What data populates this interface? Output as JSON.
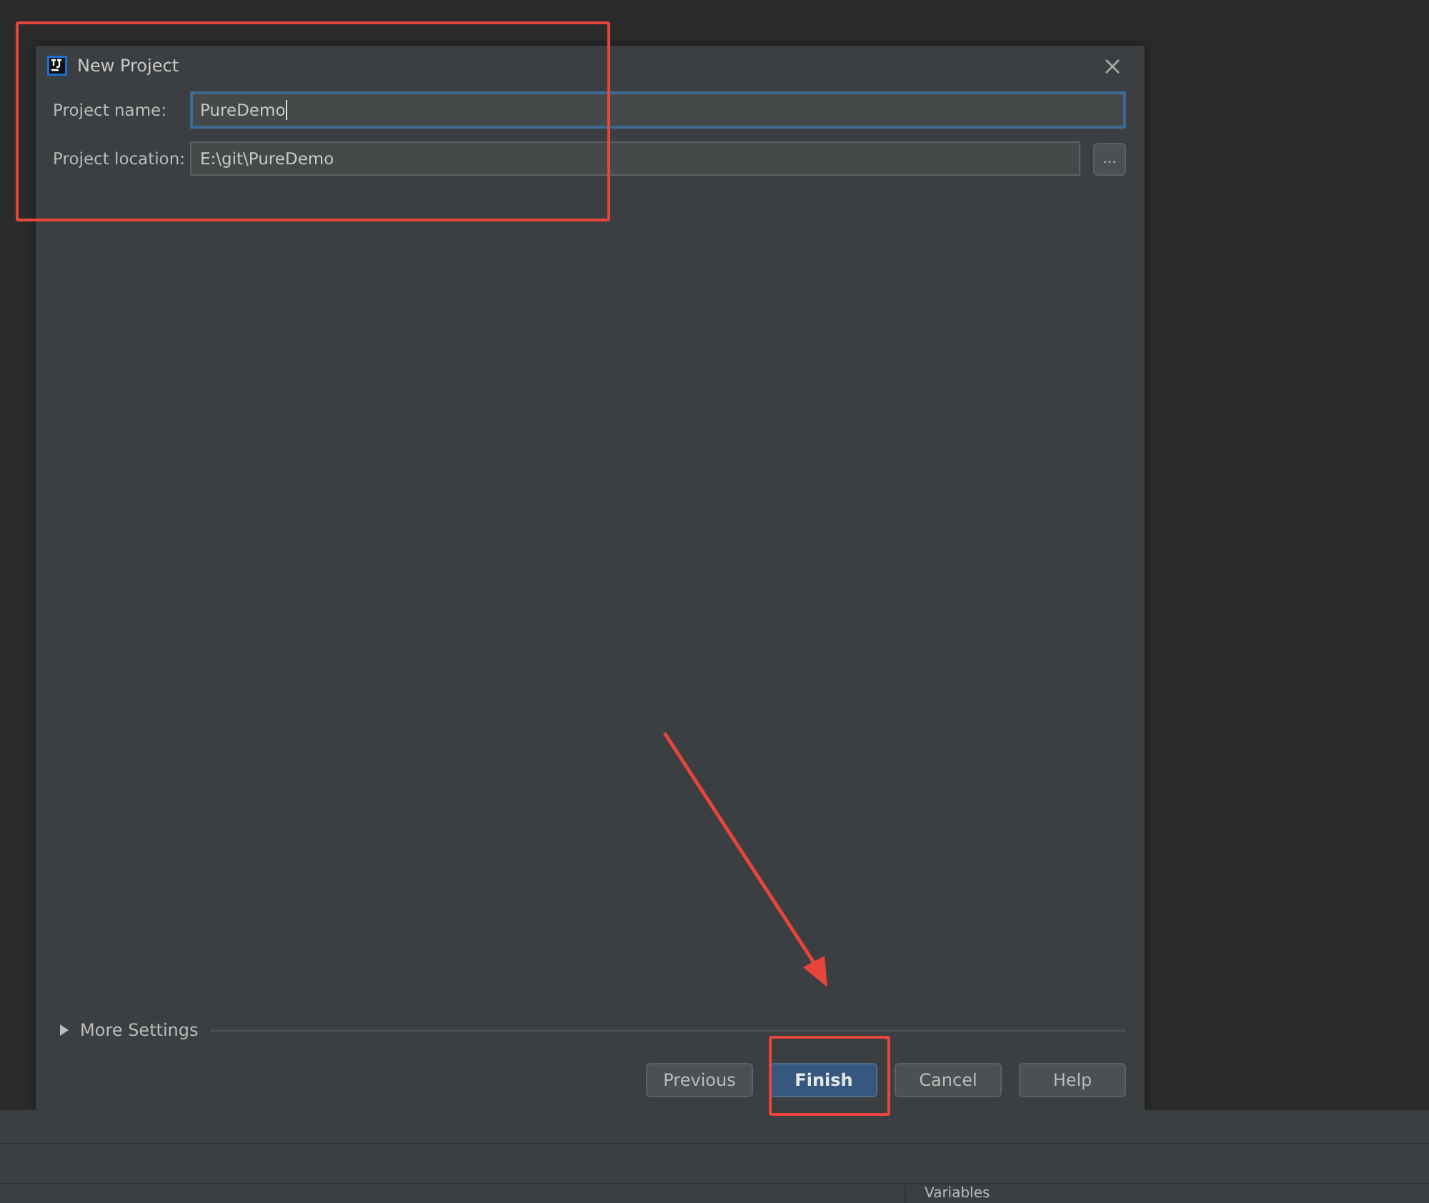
{
  "dialog": {
    "title": "New Project",
    "fields": [
      {
        "label": "Project name:",
        "value": "PureDemo",
        "focused": true,
        "browse": false
      },
      {
        "label": "Project location:",
        "value": "E:\\git\\PureDemo",
        "focused": false,
        "browse": true,
        "browse_label": "..."
      }
    ],
    "more_settings": {
      "label": "More Settings",
      "expanded": false
    },
    "buttons": [
      {
        "label": "Previous",
        "default": false
      },
      {
        "label": "Finish",
        "default": true
      },
      {
        "label": "Cancel",
        "default": false
      },
      {
        "label": "Help",
        "default": false
      }
    ]
  },
  "background_panel": {
    "variables_label": "Variables"
  }
}
